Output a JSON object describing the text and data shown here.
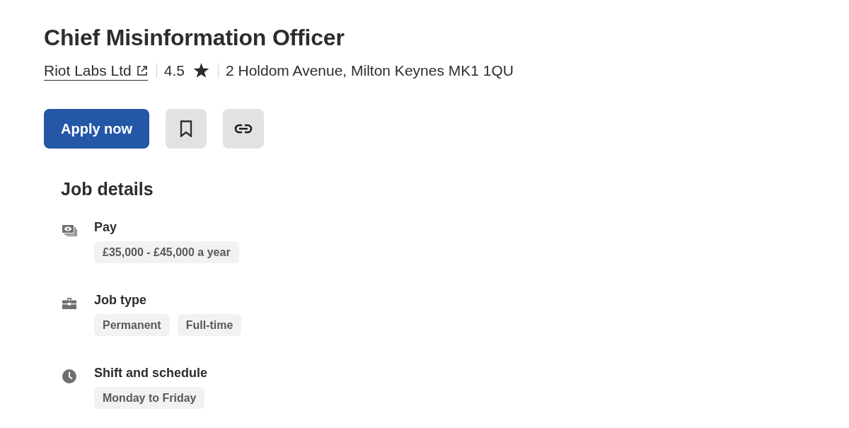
{
  "job": {
    "title": "Chief Misinformation Officer",
    "company": "Riot Labs Ltd",
    "rating": "4.5",
    "location": "2 Holdom Avenue, Milton Keynes MK1 1QU"
  },
  "actions": [
    {
      "kind": "apply",
      "label": "Apply now"
    },
    {
      "kind": "save"
    },
    {
      "kind": "copy-link"
    }
  ],
  "job_details": {
    "heading": "Job details",
    "sections": [
      {
        "kind": "pay",
        "label": "Pay",
        "tags": [
          "£35,000 - £45,000 a year"
        ]
      },
      {
        "kind": "job-type",
        "label": "Job type",
        "tags": [
          "Permanent",
          "Full-time"
        ]
      },
      {
        "kind": "schedule",
        "label": "Shift and schedule",
        "tags": [
          "Monday to Friday"
        ]
      }
    ]
  }
}
